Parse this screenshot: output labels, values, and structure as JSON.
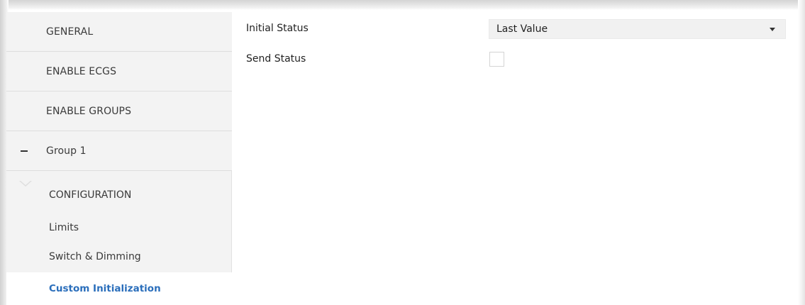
{
  "sidebar": {
    "items": [
      {
        "label": "GENERAL"
      },
      {
        "label": "ENABLE ECGS"
      },
      {
        "label": "ENABLE GROUPS"
      }
    ],
    "group": {
      "label": "Group 1"
    },
    "subitems": [
      {
        "label": "CONFIGURATION"
      },
      {
        "label": "Limits"
      },
      {
        "label": "Switch & Dimming"
      },
      {
        "label": "Custom Initialization"
      }
    ]
  },
  "main": {
    "initial_status": {
      "label": "Initial Status",
      "value": "Last Value"
    },
    "send_status": {
      "label": "Send Status",
      "checked": false
    }
  },
  "colors": {
    "active_item": "#2a6ebb",
    "sidebar_bg": "#f3f3f3"
  }
}
